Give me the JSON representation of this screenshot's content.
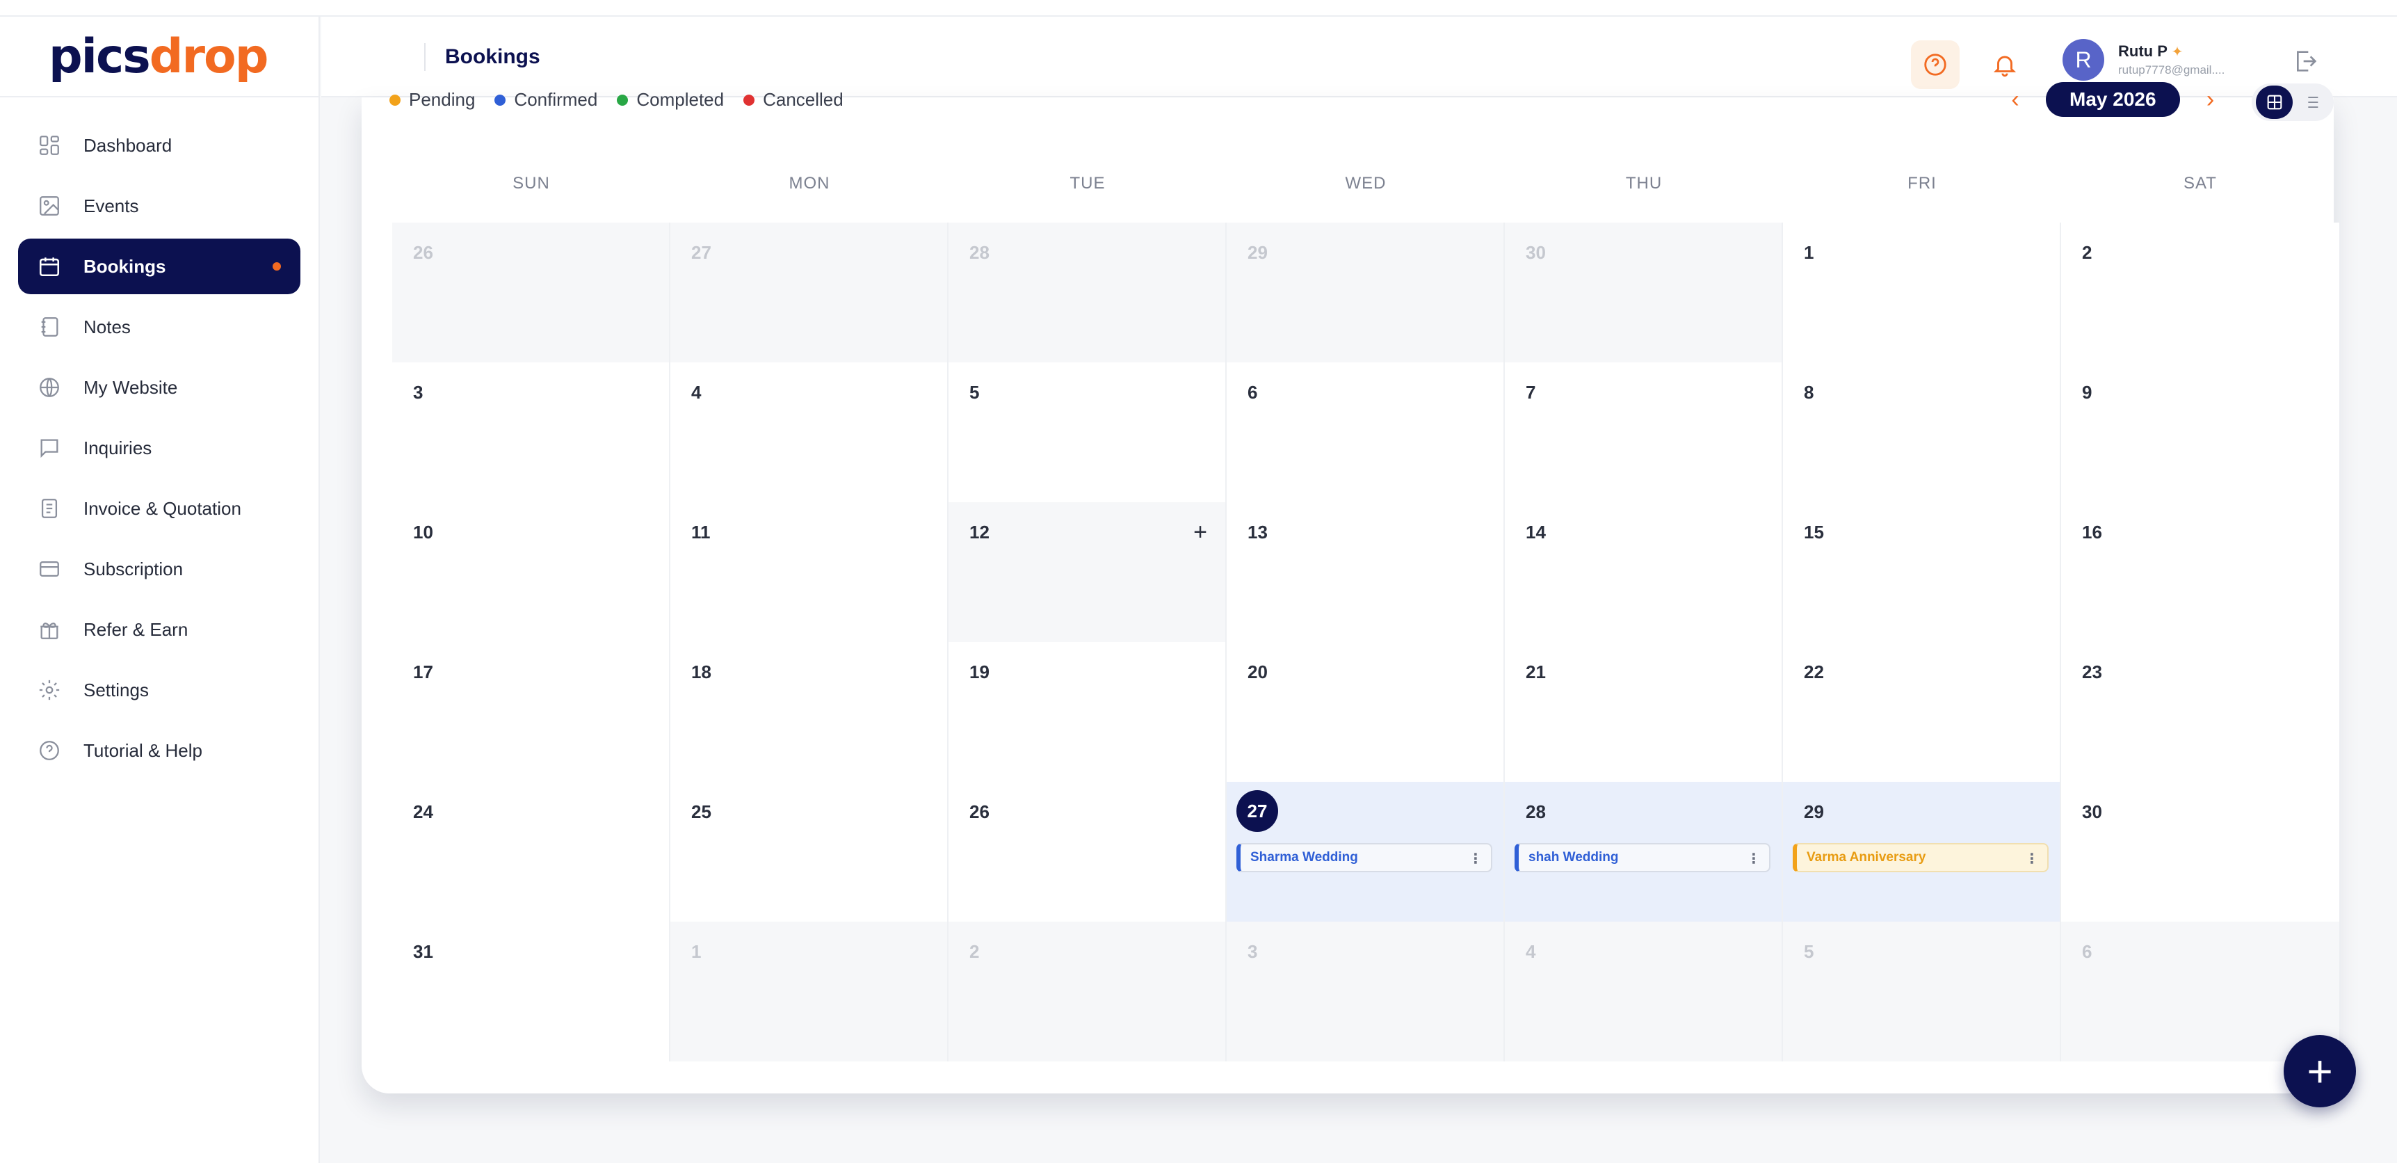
{
  "brand": {
    "part1": "pics",
    "part2": "drop"
  },
  "sidebar": {
    "items": [
      {
        "label": "Dashboard",
        "icon": "dashboard-icon"
      },
      {
        "label": "Events",
        "icon": "image-icon"
      },
      {
        "label": "Bookings",
        "icon": "calendar-icon",
        "active": true
      },
      {
        "label": "Notes",
        "icon": "notebook-icon"
      },
      {
        "label": "My Website",
        "icon": "globe-icon"
      },
      {
        "label": "Inquiries",
        "icon": "chat-icon"
      },
      {
        "label": "Invoice & Quotation",
        "icon": "document-icon"
      },
      {
        "label": "Subscription",
        "icon": "credit-card-icon"
      },
      {
        "label": "Refer & Earn",
        "icon": "gift-icon"
      },
      {
        "label": "Settings",
        "icon": "gear-icon"
      },
      {
        "label": "Tutorial & Help",
        "icon": "help-circle-icon"
      }
    ]
  },
  "header": {
    "title": "Bookings",
    "user": {
      "initial": "R",
      "name": "Rutu P",
      "email": "rutup7778@gmail...."
    }
  },
  "legend": [
    {
      "label": "Pending",
      "color": "#f2a21a"
    },
    {
      "label": "Confirmed",
      "color": "#2f5fd6"
    },
    {
      "label": "Completed",
      "color": "#28a745"
    },
    {
      "label": "Cancelled",
      "color": "#e03131"
    }
  ],
  "calendar": {
    "month_label": "May 2026",
    "weekdays": [
      "SUN",
      "MON",
      "TUE",
      "WED",
      "THU",
      "FRI",
      "SAT"
    ],
    "weeks": [
      [
        "26",
        "27",
        "28",
        "29",
        "30",
        "1",
        "2"
      ],
      [
        "3",
        "4",
        "5",
        "6",
        "7",
        "8",
        "9"
      ],
      [
        "10",
        "11",
        "12",
        "13",
        "14",
        "15",
        "16"
      ],
      [
        "17",
        "18",
        "19",
        "20",
        "21",
        "22",
        "23"
      ],
      [
        "24",
        "25",
        "26",
        "27",
        "28",
        "29",
        "30"
      ],
      [
        "31",
        "1",
        "2",
        "3",
        "4",
        "5",
        "6"
      ]
    ],
    "events": [
      {
        "title": "Sharma Wedding",
        "status": "confirmed"
      },
      {
        "title": "shah Wedding",
        "status": "confirmed"
      },
      {
        "title": "Varma Anniversary",
        "status": "pending"
      }
    ]
  },
  "colors": {
    "primary": "#0c1150",
    "accent": "#f26a21"
  }
}
